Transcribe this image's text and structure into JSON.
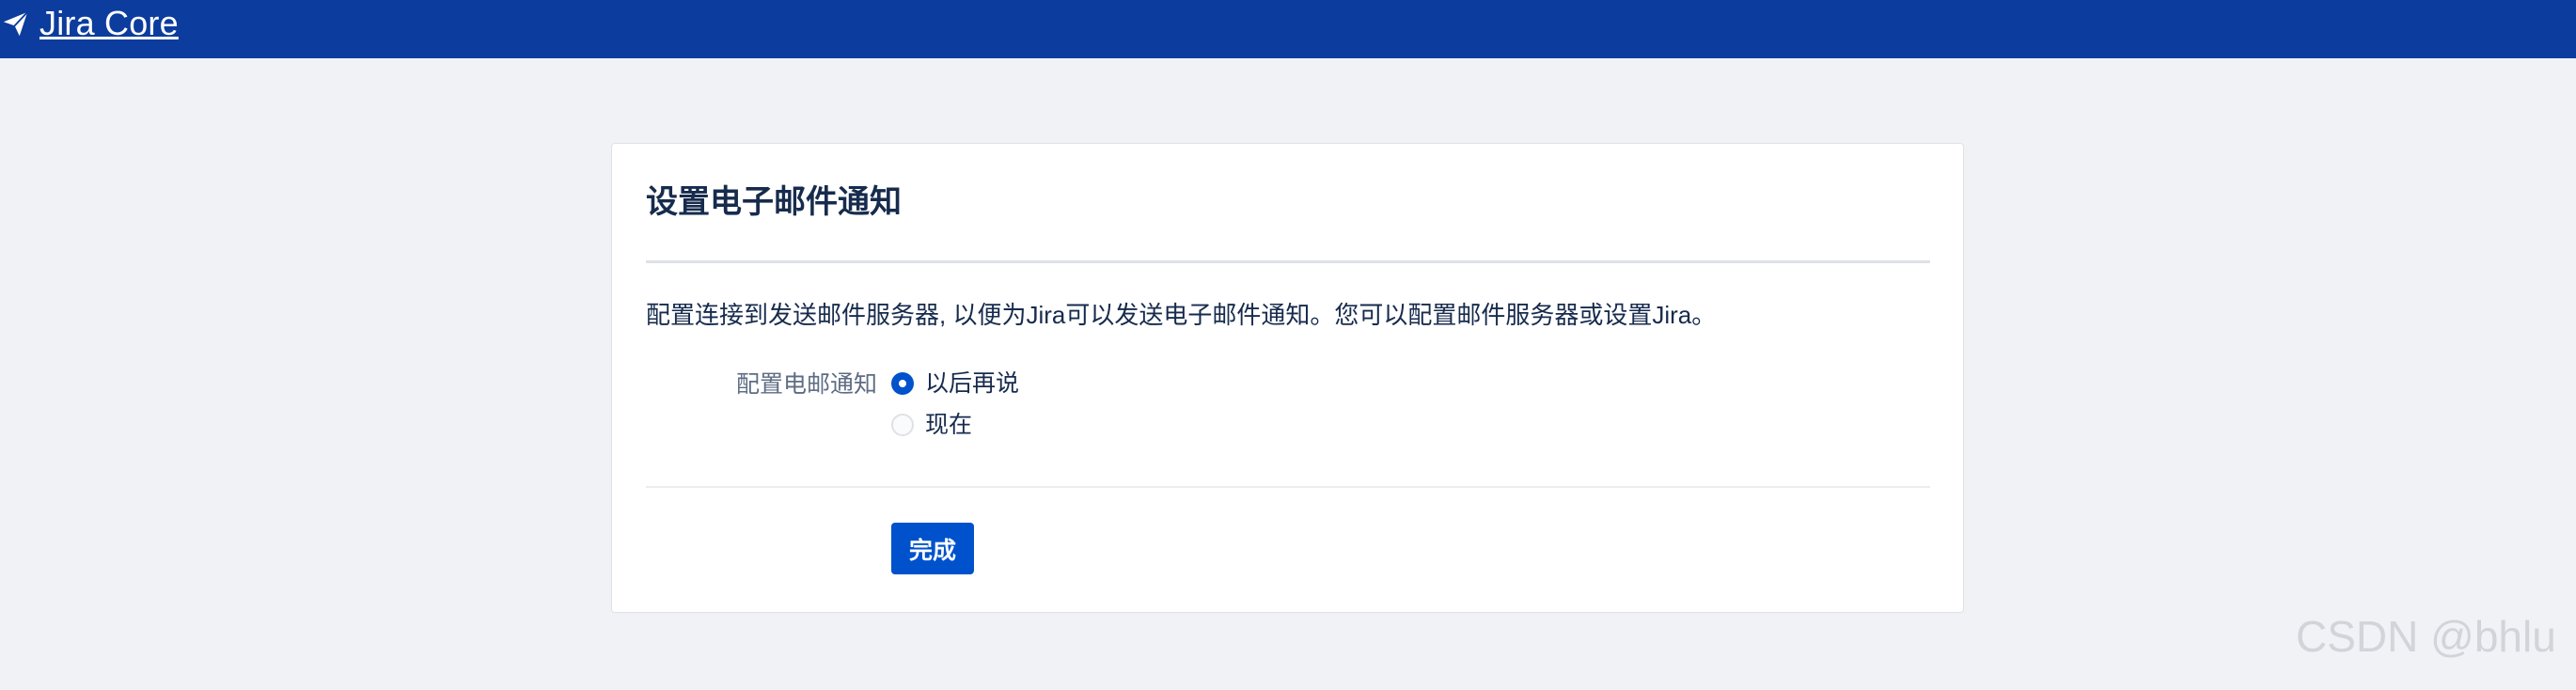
{
  "app": {
    "product_name": "Jira Core",
    "logo_icon": "paper-plane-icon"
  },
  "page": {
    "title": "设置电子邮件通知",
    "description": "配置连接到发送邮件服务器, 以便为Jira可以发送电子邮件通知。您可以配置邮件服务器或设置Jira。"
  },
  "form": {
    "field_label": "配置电邮通知",
    "options": [
      {
        "label": "以后再说",
        "selected": true
      },
      {
        "label": "现在",
        "selected": false
      }
    ],
    "submit_label": "完成"
  },
  "overlay": {
    "watermark": "CSDN @bhlu"
  },
  "colors": {
    "topbar": "#0c3c9e",
    "primary": "#0052cc",
    "background": "#f1f2f5",
    "card": "#ffffff",
    "text": "#172b4d",
    "muted_text": "#5e6c84",
    "divider": "#dfe1e6",
    "watermark": "#d2d4d9"
  }
}
